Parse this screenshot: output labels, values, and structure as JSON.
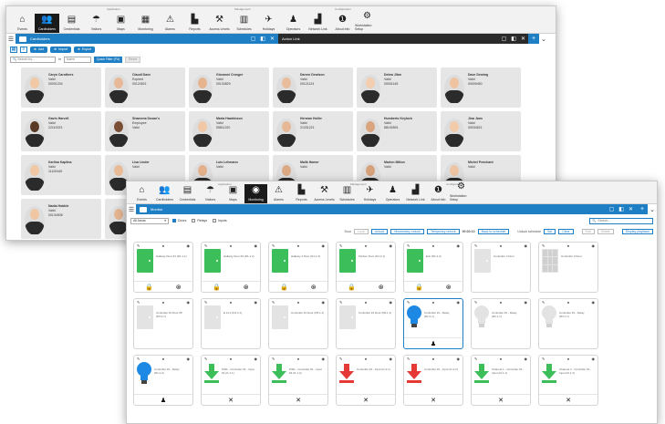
{
  "back": {
    "toolbar": {
      "group_labels": [
        "Application",
        "Management",
        "Configuration"
      ],
      "items": [
        {
          "label": "Events",
          "icon": "home-icon",
          "glyph": "⌂"
        },
        {
          "label": "Cardholders",
          "icon": "cardholders-icon",
          "glyph": "👥",
          "active": true
        },
        {
          "label": "Credentials",
          "icon": "credentials-icon",
          "glyph": "▤"
        },
        {
          "label": "Visitors",
          "icon": "visitors-icon",
          "glyph": "☂"
        },
        {
          "label": "Maps",
          "icon": "maps-icon",
          "glyph": "▣"
        },
        {
          "label": "Monitoring",
          "icon": "monitoring-icon",
          "glyph": "▦"
        },
        {
          "label": "Alarms",
          "icon": "alarm-icon",
          "glyph": "⚠"
        },
        {
          "label": "Reports",
          "icon": "reports-icon",
          "glyph": "▙"
        },
        {
          "label": "Access Levels",
          "icon": "access-levels-icon",
          "glyph": "⚒"
        },
        {
          "label": "Schedules",
          "icon": "schedules-icon",
          "glyph": "▥"
        },
        {
          "label": "Holidays",
          "icon": "holidays-icon",
          "glyph": "✈"
        },
        {
          "label": "Operators",
          "icon": "operators-icon",
          "glyph": "♟"
        },
        {
          "label": "Network Link",
          "icon": "network-icon",
          "glyph": "▟"
        },
        {
          "label": "About Info",
          "icon": "info-icon",
          "glyph": "❶"
        },
        {
          "label": "Workstation Setup",
          "icon": "settings-icon",
          "glyph": "⚙"
        }
      ]
    },
    "tab_title": "Cardholders",
    "tab_controls": [
      "▢",
      "◧",
      "✕"
    ],
    "side_tab_title": "Action Link",
    "side_controls": [
      "▢",
      "◧",
      "✕"
    ],
    "actions": {
      "add": "Add",
      "import": "Import",
      "export": "Export"
    },
    "filters": {
      "search_placeholder": "Search by...",
      "in_label": "In",
      "in_value": "Name",
      "quick_filter": "Quick Filter (F4)",
      "reset": "Reset"
    },
    "cards": [
      {
        "name": "Caryn Carothers",
        "status": "Valid",
        "number": "00001234",
        "skin": "#f1c9a5"
      },
      {
        "name": "Claudi Dave",
        "status": "Expired",
        "number": "00124521",
        "skin": "#e8b998"
      },
      {
        "name": "Giovanni Crosger",
        "status": "Valid",
        "number": "00134829",
        "skin": "#e5b48f"
      },
      {
        "name": "Darren Dewison",
        "status": "Valid",
        "number": "00121124",
        "skin": "#e9bd9b"
      },
      {
        "name": "Debra Jilan",
        "status": "Valid",
        "number": "00001145",
        "skin": "#f2cdb0"
      },
      {
        "name": "Dave Deming",
        "status": "Valid",
        "number": "00009450",
        "skin": "#efc3a0"
      },
      {
        "name": "Gavin Harvell",
        "status": "Valid",
        "number": "22110023",
        "skin": "#5a3a26"
      },
      {
        "name": "Shamena Dosan's",
        "status": "Employee",
        "number": "Valid",
        "skin": "#7a4e34"
      },
      {
        "name": "Marta Hawkinson",
        "status": "Valid",
        "number": "55811220",
        "skin": "#f0c8a6"
      },
      {
        "name": "Herman Holler",
        "status": "Valid",
        "number": "21331221",
        "skin": "#e6b896"
      },
      {
        "name": "Humberto Keylock",
        "status": "Valid",
        "number": "88190591",
        "skin": "#d9a47e"
      },
      {
        "name": "Jina Jans",
        "status": "Valid",
        "number": "00034521",
        "skin": "#f2cbaa"
      },
      {
        "name": "Karlina Kaplina",
        "status": "Valid",
        "number": "11100445",
        "skin": "#f1c7a4"
      },
      {
        "name": "Lisa Linder",
        "status": "Valid",
        "number": "",
        "skin": "#e8ba96"
      },
      {
        "name": "Luis Lehmann",
        "status": "Valid",
        "number": "",
        "skin": "#e3b08b"
      },
      {
        "name": "Malik Hamer",
        "status": "Valid",
        "number": "",
        "skin": "#dca985"
      },
      {
        "name": "Marlon Milton",
        "status": "Valid",
        "number": "",
        "skin": "#d6a07a"
      },
      {
        "name": "Michel Penchant",
        "status": "Valid",
        "number": "",
        "skin": "#efc4a3"
      },
      {
        "name": "Nadia Hobble",
        "status": "Valid",
        "number": "00134908",
        "skin": "#f0c6a3"
      },
      {
        "name": "",
        "status": "",
        "number": "",
        "skin": "#e4b591"
      }
    ]
  },
  "front": {
    "toolbar": {
      "group_labels": [
        "Application",
        "Management",
        "Configuration"
      ],
      "items": [
        {
          "label": "Events",
          "icon": "home-icon",
          "glyph": "⌂"
        },
        {
          "label": "Cardholders",
          "icon": "cardholders-icon",
          "glyph": "👥"
        },
        {
          "label": "Credentials",
          "icon": "credentials-icon",
          "glyph": "▤"
        },
        {
          "label": "Visitors",
          "icon": "visitors-icon",
          "glyph": "☂"
        },
        {
          "label": "Maps",
          "icon": "maps-icon",
          "glyph": "▣"
        },
        {
          "label": "Monitoring",
          "icon": "monitoring-icon",
          "glyph": "◉",
          "active": true
        },
        {
          "label": "Alarms",
          "icon": "alarm-icon",
          "glyph": "⚠"
        },
        {
          "label": "Reports",
          "icon": "reports-icon",
          "glyph": "▙"
        },
        {
          "label": "Access Levels",
          "icon": "access-levels-icon",
          "glyph": "⚒"
        },
        {
          "label": "Schedules",
          "icon": "schedules-icon",
          "glyph": "▥"
        },
        {
          "label": "Holidays",
          "icon": "holidays-icon",
          "glyph": "✈"
        },
        {
          "label": "Operators",
          "icon": "operators-icon",
          "glyph": "♟"
        },
        {
          "label": "Network Link",
          "icon": "network-icon",
          "glyph": "▟"
        },
        {
          "label": "About Info",
          "icon": "info-icon",
          "glyph": "❶"
        },
        {
          "label": "Workstation Setup",
          "icon": "settings-icon",
          "glyph": "⚙"
        }
      ]
    },
    "tab_title": "Monitor",
    "tab_controls": [
      "▢",
      "◧",
      "✕"
    ],
    "filter": {
      "select_value": "All Areas",
      "checks": [
        {
          "label": "Doors",
          "checked": true
        },
        {
          "label": "Relays",
          "checked": false
        },
        {
          "label": "Inputs",
          "checked": false
        }
      ],
      "search_placeholder": "Search..."
    },
    "controls": {
      "door_label": "Door",
      "lock": "Lock",
      "unlock": "Unlock",
      "momentary": "Momentary unlock",
      "temporary": "Temporary unlock",
      "temporary_value": "00:00:10",
      "back_schedule": "Back to schedule",
      "unlock_label": "Unlock schedule",
      "set": "Set",
      "clear": "Clear",
      "edit": "Edit",
      "delete": "Delete",
      "display_playback": "Display playback"
    },
    "tiles": [
      {
        "kind": "door-green",
        "label": "Hallway Door #1 (D1.1.1)",
        "bottom": [
          "lock-icon",
          "rss-icon"
        ],
        "selected": false
      },
      {
        "kind": "door-green",
        "label": "Hallway Door #2 (D1.1.2)",
        "bottom": [
          "lock-icon",
          "rss-icon"
        ],
        "selected": false
      },
      {
        "kind": "door-green",
        "label": "Hallway 4 Door (D1.1.3)",
        "bottom": [
          "lock-icon",
          "rss-icon"
        ],
        "selected": false
      },
      {
        "kind": "door-green",
        "label": "Kitchen Door (D1.2.1)",
        "bottom": [
          "lock-icon",
          "rss-icon"
        ],
        "selected": false
      },
      {
        "kind": "door-green",
        "label": "Exit (D1.2.2)",
        "bottom": [
          "lock-icon",
          "rss-icon"
        ],
        "selected": false
      },
      {
        "kind": "door-grey",
        "label": "Controller 2 Door",
        "bottom": [],
        "selected": false
      },
      {
        "kind": "window-grey",
        "label": "Controller 3 Door",
        "bottom": [],
        "selected": false
      },
      {
        "kind": "door-grey",
        "label": "Controller #1 Door #5 (D3.2.1)",
        "bottom": [],
        "selected": false
      },
      {
        "kind": "door-grey",
        "label": "E 11.2 (D4.2.1)",
        "bottom": [],
        "selected": false
      },
      {
        "kind": "door-grey",
        "label": "Controller #1 Door (D5.1.1)",
        "bottom": [],
        "selected": false
      },
      {
        "kind": "door-grey",
        "label": "Controller #1 Door (D6.1.1)",
        "bottom": [],
        "selected": false
      },
      {
        "kind": "bulb-blue",
        "label": "Controller #1 - Relay (R1.1.1)",
        "bottom": [
          "person-icon"
        ],
        "selected": true
      },
      {
        "kind": "bulb-grey",
        "label": "Controller #1 - Relay (R2.1.1)",
        "bottom": [],
        "selected": false
      },
      {
        "kind": "bulb-grey",
        "label": "Controller #1 - Relay (R3.1.1)",
        "bottom": [],
        "selected": false
      },
      {
        "kind": "bulb-blue",
        "label": "Controller #1 - Relay (R1.1.2)",
        "bottom": [
          "person-icon"
        ],
        "selected": false
      },
      {
        "kind": "arrow-green",
        "label": "PIR1 - Controller #1 - Input #1 (I1.1.1)",
        "bottom": [
          "close-icon"
        ],
        "selected": false
      },
      {
        "kind": "arrow-green",
        "label": "PIR1 - Controller #1 - Input #2 (I1.1.2)",
        "bottom": [
          "close-icon"
        ],
        "selected": false
      },
      {
        "kind": "arrow-red",
        "label": "Controller #1 - Input (I1.2.1)",
        "bottom": [
          "close-icon"
        ],
        "selected": false
      },
      {
        "kind": "arrow-red",
        "label": "Controller #1 - Input (I1.2.2)",
        "bottom": [
          "close-icon"
        ],
        "selected": false
      },
      {
        "kind": "arrow-green",
        "label": "Channel 1 - Controller #1 - Input (I2.1.1)",
        "bottom": [
          "close-icon"
        ],
        "selected": false
      },
      {
        "kind": "arrow-green",
        "label": "Channel 2 - Controller #1 - Input (I2.1.2)",
        "bottom": [
          "close-icon"
        ],
        "selected": false
      }
    ]
  },
  "colors": {
    "accent": "#1e7fc4",
    "dark": "#2a2a2a",
    "green": "#3cbf5a",
    "red": "#e53935",
    "bulb": "#1e88e5"
  }
}
